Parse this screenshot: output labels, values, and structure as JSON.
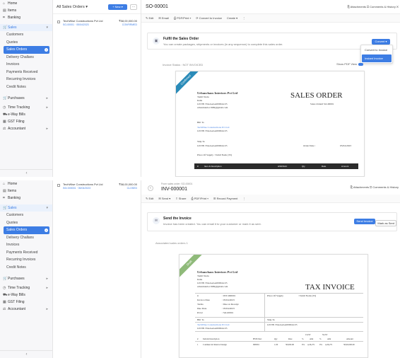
{
  "sidebar": {
    "items": [
      {
        "icon": "home-icon",
        "label": "Home",
        "glyph": "⌂"
      },
      {
        "icon": "items-icon",
        "label": "Items",
        "glyph": "▤"
      },
      {
        "icon": "bank-icon",
        "label": "Banking",
        "glyph": "⌗"
      }
    ],
    "sales_label": "Sales",
    "sub_items": [
      "Customers",
      "Quotes",
      "Sales Orders",
      "Delivery Challans",
      "Invoices",
      "Payments Received",
      "Recurring Invoices",
      "Credit Notes"
    ],
    "active_sub": "Sales Orders",
    "bottom_items": [
      {
        "icon": "cart-icon",
        "label": "Purchases",
        "glyph": "🛒"
      },
      {
        "icon": "clock-icon",
        "label": "Time Tracking",
        "glyph": "◷"
      },
      {
        "icon": "truck-icon",
        "label": "e-Way Bills",
        "glyph": "⛟"
      },
      {
        "icon": "gst-icon",
        "label": "GST Filing",
        "glyph": "▦"
      },
      {
        "icon": "accountant-icon",
        "label": "Accountant",
        "glyph": "⚖"
      }
    ],
    "collapse_glyph": "‹"
  },
  "panel1": {
    "list_title": "All Sales Orders ▾",
    "new_button": "+ New ▾",
    "more_button": "···",
    "row": {
      "customer": "TechWise Constructions Pvt Ltd",
      "number": "SO-00001 · 05/04/2023",
      "amount": "₹58,00,000.00",
      "status": "CONFIRMED"
    },
    "title": "SO-00001",
    "topright": "⎘ Attachments  ☐ Comments & History  ✕",
    "toolbar": [
      "✎ Edit",
      "✉ Email",
      "⎙ PDF/Print ▾",
      "⟳ Convert to Invoice",
      "Create ▾",
      "⋮"
    ],
    "banner_title": "Fulfil the Sales Order",
    "banner_desc": "You can create packages, shipments or invoices (in any sequence) to complete this sales order.",
    "convert_button": "Convert ▾",
    "dropdown": [
      "Convert to Invoice",
      "Instant Invoice"
    ],
    "invoice_status": "Invoice Status : NOT INVOICED",
    "pdf_view": "Show PDF View",
    "doc": {
      "ribbon": "Confirmed",
      "company": "Urbanchaos Interiors Pvt Ltd",
      "addr": [
        "Tamil Nadu",
        "India",
        "GSTIN 33AAAAA0000A1Z5",
        "urbaninterior1999@gmail.com"
      ],
      "doc_title": "SALES ORDER",
      "order_no": "Sales Order# SO-00001",
      "bill_to": "Bill To",
      "customer": "TechWise Constructions Pvt Ltd",
      "cust_gstin": "GSTIN 33AAAAA0000A1Z5",
      "ship_to": "Ship To",
      "ship_gstin": "GSTIN 33AAAAA0000A1Z5",
      "order_date_label": "Order Date :",
      "order_date": "05/04/2023",
      "supply": "Place Of Supply : Tamil Nadu (33)",
      "cols": [
        "#",
        "Item & Description",
        "HSN/SAC",
        "Qty",
        "Rate",
        "Amount"
      ]
    }
  },
  "panel2": {
    "row": {
      "customer": "TechWise Constructions Pvt Ltd",
      "number": "INV-000001 · 05/04/2023",
      "amount": "₹58,00,000.00",
      "status": "CLOSED"
    },
    "subtitle": "From sales order: SO-00001",
    "title": "INV-000001",
    "back": "‹",
    "topright": "⎘ Attachments  ☐ Comments & History",
    "toolbar": [
      "✎ Edit",
      "✉ Send ▾",
      "⇪ Share",
      "⎙ PDF/Print ▾",
      "☰ Record Payment",
      "⋮"
    ],
    "banner_title": "Send the Invoice",
    "banner_desc": "Invoice has been created. You can email it to your customer or mark it as sent.",
    "send_button": "Send Invoice",
    "mark_sent": "Mark as Sent",
    "assoc": "Associated sales orders  1",
    "doc": {
      "ribbon": "Draft",
      "company": "Urbanchaos Interiors Pvt Ltd",
      "addr": [
        "Tamil Nadu",
        "India",
        "GSTIN 33AAAAA0000A1Z5",
        "urbaninterior1999@gmail.com"
      ],
      "doc_title": "TAX INVOICE",
      "meta": [
        [
          "#",
          ": INV-000001"
        ],
        [
          "Invoice Date",
          ": 05/04/2023"
        ],
        [
          "Terms",
          ": Due on Receipt"
        ],
        [
          "Due Date",
          ": 05/04/2023"
        ],
        [
          "P.O.#",
          ": SO-00001"
        ]
      ],
      "supply_label": "Place Of Supply",
      "supply_val": ": Tamil Nadu (33)",
      "bill_to": "Bill To",
      "customer": "TechWise Constructions Pvt Ltd",
      "cust_gstin": "GSTIN 33AAAAA0000A1Z5",
      "ship_to": "Ship To",
      "ship_gstin": "GSTIN 33AAAAA0000A1Z5",
      "cols": [
        "#",
        "Item & Description",
        "HSN/SAC",
        "Qty",
        "Rate",
        "CGST",
        "SGST",
        "Amount"
      ],
      "subcols": [
        "%",
        "Amt",
        "%",
        "Amt"
      ],
      "line": [
        "1",
        "Commercial Interior Design",
        "998391",
        "1.00",
        "58,000.00",
        "9%",
        "4,26,271",
        "9%",
        "4,26,271",
        "58,00,000.00"
      ]
    }
  },
  "colors": {
    "accent": "#3d7de4",
    "ribbon_blue": "#2a8bb8",
    "ribbon_green": "#8fba7a"
  }
}
